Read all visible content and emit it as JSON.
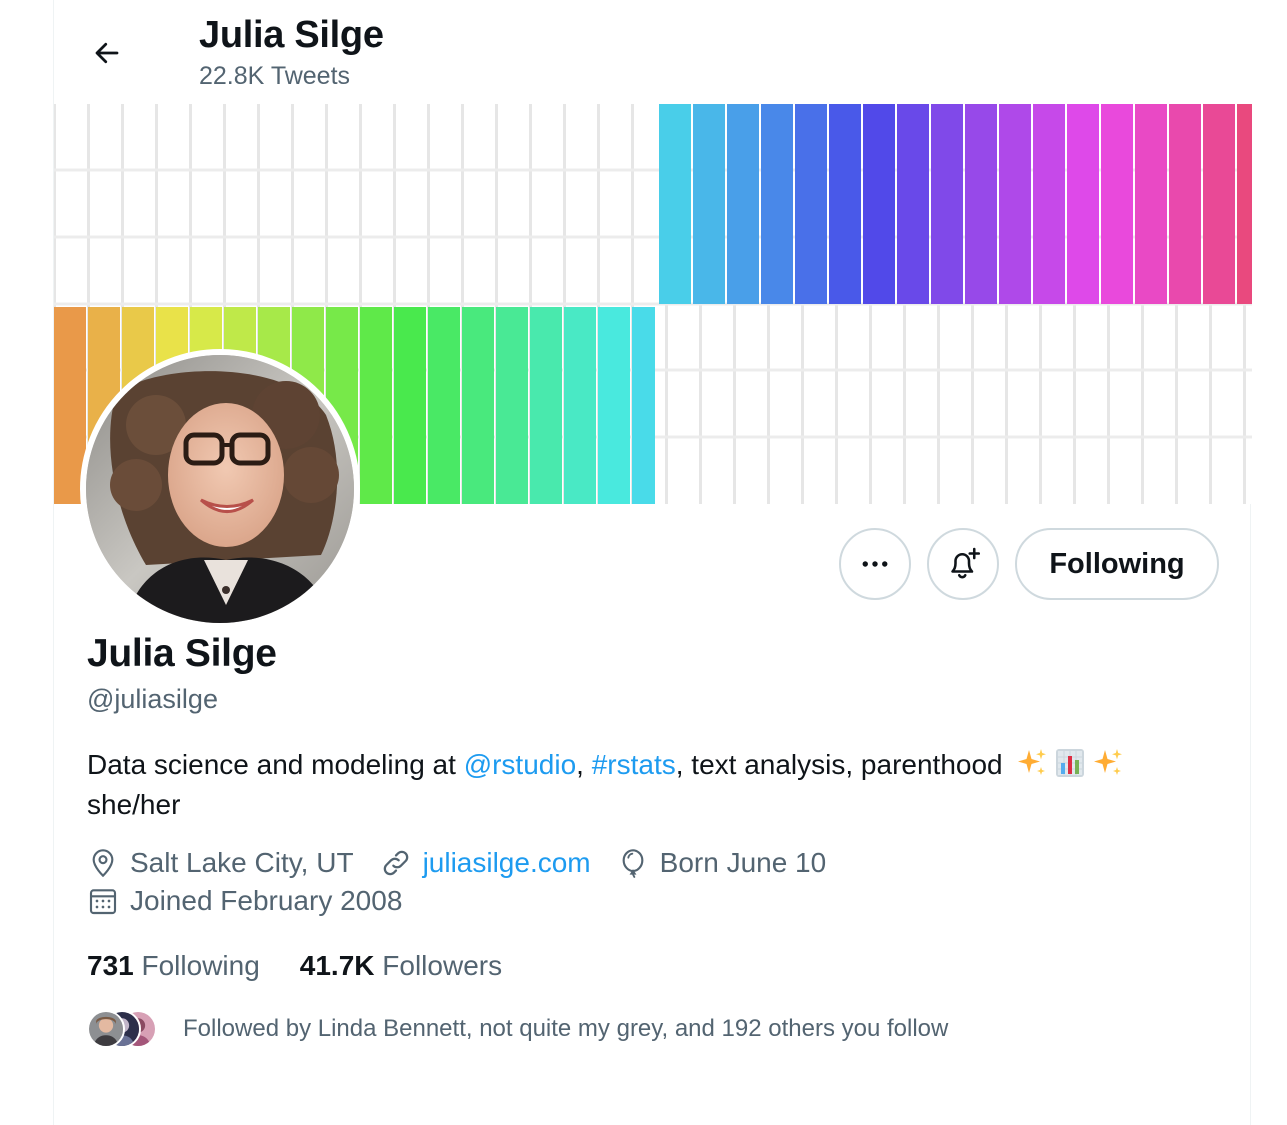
{
  "header": {
    "name": "Julia Silge",
    "tweet_count": "22.8K Tweets"
  },
  "profile": {
    "display_name": "Julia Silge",
    "handle": "@juliasilge",
    "bio": {
      "prefix": "Data science and modeling at ",
      "mention": "@rstudio",
      "sep1": ", ",
      "hashtag": "#rstats",
      "suffix": ", text analysis, parenthood",
      "line2": "she/her",
      "emoji": [
        "sparkles",
        "bar-chart",
        "sparkles"
      ]
    },
    "location": "Salt Lake City, UT",
    "website": "juliasilge.com",
    "birthday": "Born June 10",
    "joined": "Joined February 2008"
  },
  "actions": {
    "more_icon": "more-icon",
    "notify_icon": "bell-plus-icon",
    "follow_state": "Following"
  },
  "stats": {
    "following_count": "731",
    "following_label": "Following",
    "followers_count": "41.7K",
    "followers_label": "Followers"
  },
  "followed_by": {
    "text": "Followed by Linda Bennett, not quite my grey, and 192 others you follow"
  },
  "colors": {
    "accent": "#1d9bf0",
    "secondary_text": "#536471",
    "border": "#cfd9de"
  }
}
